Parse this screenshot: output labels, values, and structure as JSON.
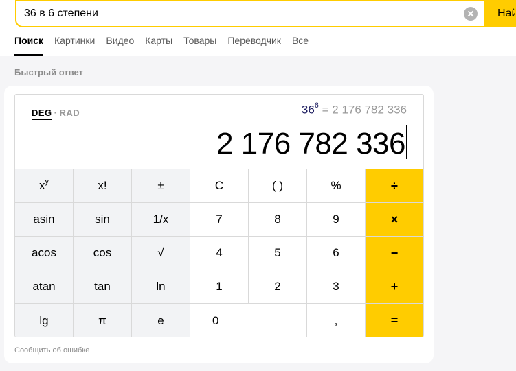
{
  "search": {
    "query": "36 в 6 степени",
    "button_label": "Найти"
  },
  "tabs": [
    {
      "label": "Поиск",
      "active": true
    },
    {
      "label": "Картинки"
    },
    {
      "label": "Видео"
    },
    {
      "label": "Карты"
    },
    {
      "label": "Товары"
    },
    {
      "label": "Переводчик"
    },
    {
      "label": "Все"
    }
  ],
  "quick_answer_label": "Быстрый ответ",
  "calculator": {
    "mode_deg": "DEG",
    "mode_sep": "·",
    "mode_rad": "RAD",
    "expression": {
      "base": "36",
      "exponent": "6",
      "rest": " = 2 176 782 336"
    },
    "result": "2 176 782 336",
    "keys": {
      "xy_base": "x",
      "xy_exp": "y",
      "factorial": "x!",
      "plus_minus": "±",
      "clear": "C",
      "parens": "( )",
      "percent": "%",
      "divide": "÷",
      "asin": "asin",
      "sin": "sin",
      "reciprocal": "1/x",
      "seven": "7",
      "eight": "8",
      "nine": "9",
      "multiply": "×",
      "acos": "acos",
      "cos": "cos",
      "sqrt": "√",
      "four": "4",
      "five": "5",
      "six": "6",
      "minus": "−",
      "atan": "atan",
      "tan": "tan",
      "ln": "ln",
      "one": "1",
      "two": "2",
      "three": "3",
      "plus": "+",
      "lg": "lg",
      "pi": "π",
      "e": "e",
      "zero": "0",
      "comma": ",",
      "equals": "="
    }
  },
  "report_error": "Сообщить об ошибке",
  "colors": {
    "accent": "#ffcc00",
    "function_key_bg": "#f2f3f5"
  }
}
